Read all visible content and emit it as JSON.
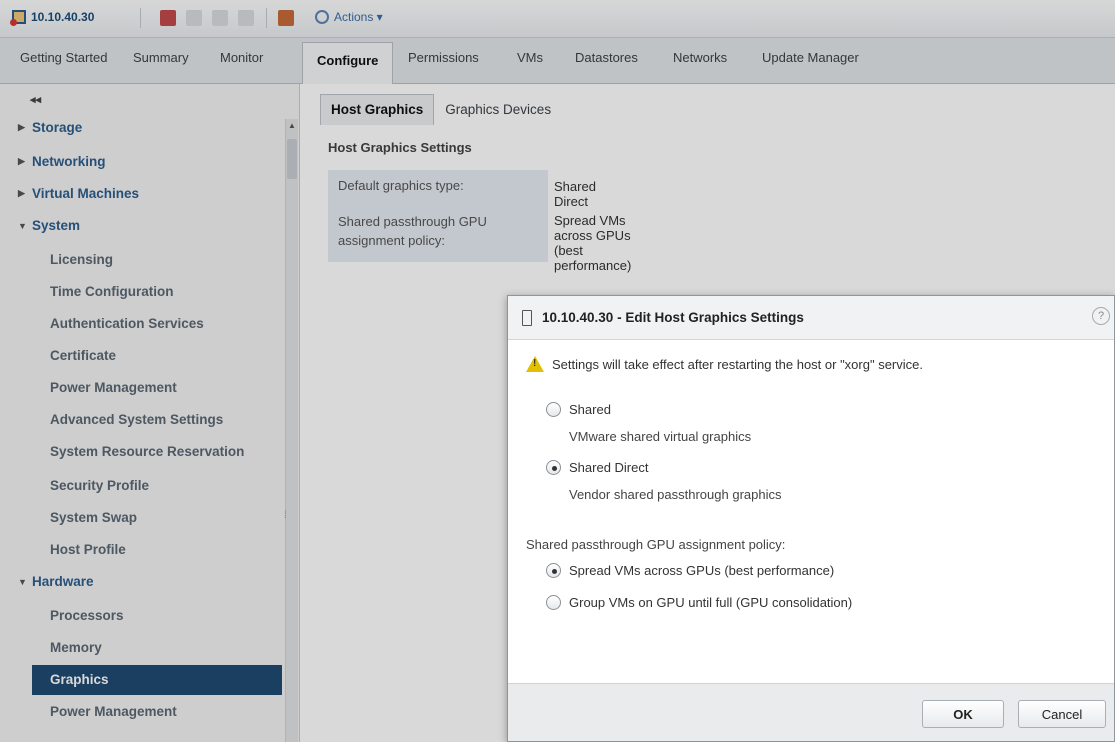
{
  "toolbar": {
    "host_title": "10.10.40.30",
    "actions_label": "Actions ▾"
  },
  "tabs": [
    {
      "label": "Getting Started"
    },
    {
      "label": "Summary"
    },
    {
      "label": "Monitor"
    },
    {
      "label": "Configure"
    },
    {
      "label": "Permissions"
    },
    {
      "label": "VMs"
    },
    {
      "label": "Datastores"
    },
    {
      "label": "Networks"
    },
    {
      "label": "Update Manager"
    }
  ],
  "sidebar": {
    "collapse": "◂◂",
    "groups": [
      {
        "label": "Storage",
        "arrow": "▶"
      },
      {
        "label": "Networking",
        "arrow": "▶"
      },
      {
        "label": "Virtual Machines",
        "arrow": "▶"
      },
      {
        "label": "System",
        "arrow": "▼"
      },
      {
        "label": "Hardware",
        "arrow": "▼"
      }
    ],
    "system_items": [
      {
        "label": "Licensing"
      },
      {
        "label": "Time Configuration"
      },
      {
        "label": "Authentication Services"
      },
      {
        "label": "Certificate"
      },
      {
        "label": "Power Management"
      },
      {
        "label": "Advanced System Settings"
      },
      {
        "label": "System Resource Reservation"
      },
      {
        "label": "Security Profile"
      },
      {
        "label": "System Swap"
      },
      {
        "label": "Host Profile"
      }
    ],
    "hardware_items": [
      {
        "label": "Processors"
      },
      {
        "label": "Memory"
      },
      {
        "label": "Graphics"
      },
      {
        "label": "Power Management"
      }
    ]
  },
  "main": {
    "subtabs": [
      {
        "label": "Host Graphics"
      },
      {
        "label": "Graphics Devices"
      }
    ],
    "section_title": "Host Graphics Settings",
    "settings": [
      {
        "label": "Default graphics type:",
        "value": "Shared Direct"
      },
      {
        "label": "Shared passthrough GPU assignment policy:",
        "value": "Spread VMs across GPUs (best performance)"
      }
    ]
  },
  "dialog": {
    "title": "10.10.40.30 - Edit Host Graphics Settings",
    "help": "?",
    "warning": "Settings will take effect after restarting the host or \"xorg\" service.",
    "graphics_options": [
      {
        "label": "Shared",
        "desc": "VMware shared virtual graphics",
        "checked": false
      },
      {
        "label": "Shared Direct",
        "desc": "Vendor shared passthrough graphics",
        "checked": true
      }
    ],
    "policy_label": "Shared passthrough GPU assignment policy:",
    "policy_options": [
      {
        "label": "Spread VMs across GPUs (best performance)",
        "checked": true
      },
      {
        "label": "Group VMs on GPU until full (GPU consolidation)",
        "checked": false
      }
    ],
    "ok_label": "OK",
    "cancel_label": "Cancel"
  }
}
